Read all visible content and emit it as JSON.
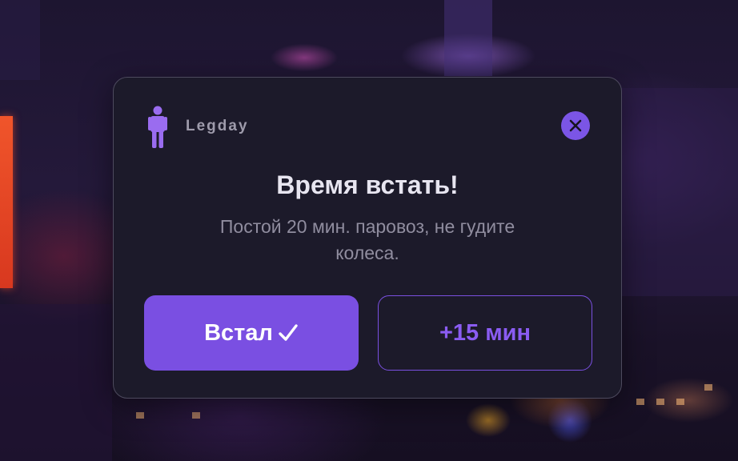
{
  "notification": {
    "app_name": "Legday",
    "app_icon": "standing-person-icon",
    "close_icon": "close-icon",
    "title": "Время встать!",
    "message": "Постой 20 мин. паровоз, не гудите колеса.",
    "primary_button": {
      "label": "Встал",
      "icon": "checkmark-icon"
    },
    "secondary_button": {
      "label": "+15 мин"
    }
  },
  "colors": {
    "accent": "#7a4fe2",
    "card_background": "#1c1a2a",
    "card_border": "#4d4a5e",
    "title_text": "#e7e5f0",
    "message_text": "#908d9f",
    "secondary_text": "#8a5cf2"
  }
}
